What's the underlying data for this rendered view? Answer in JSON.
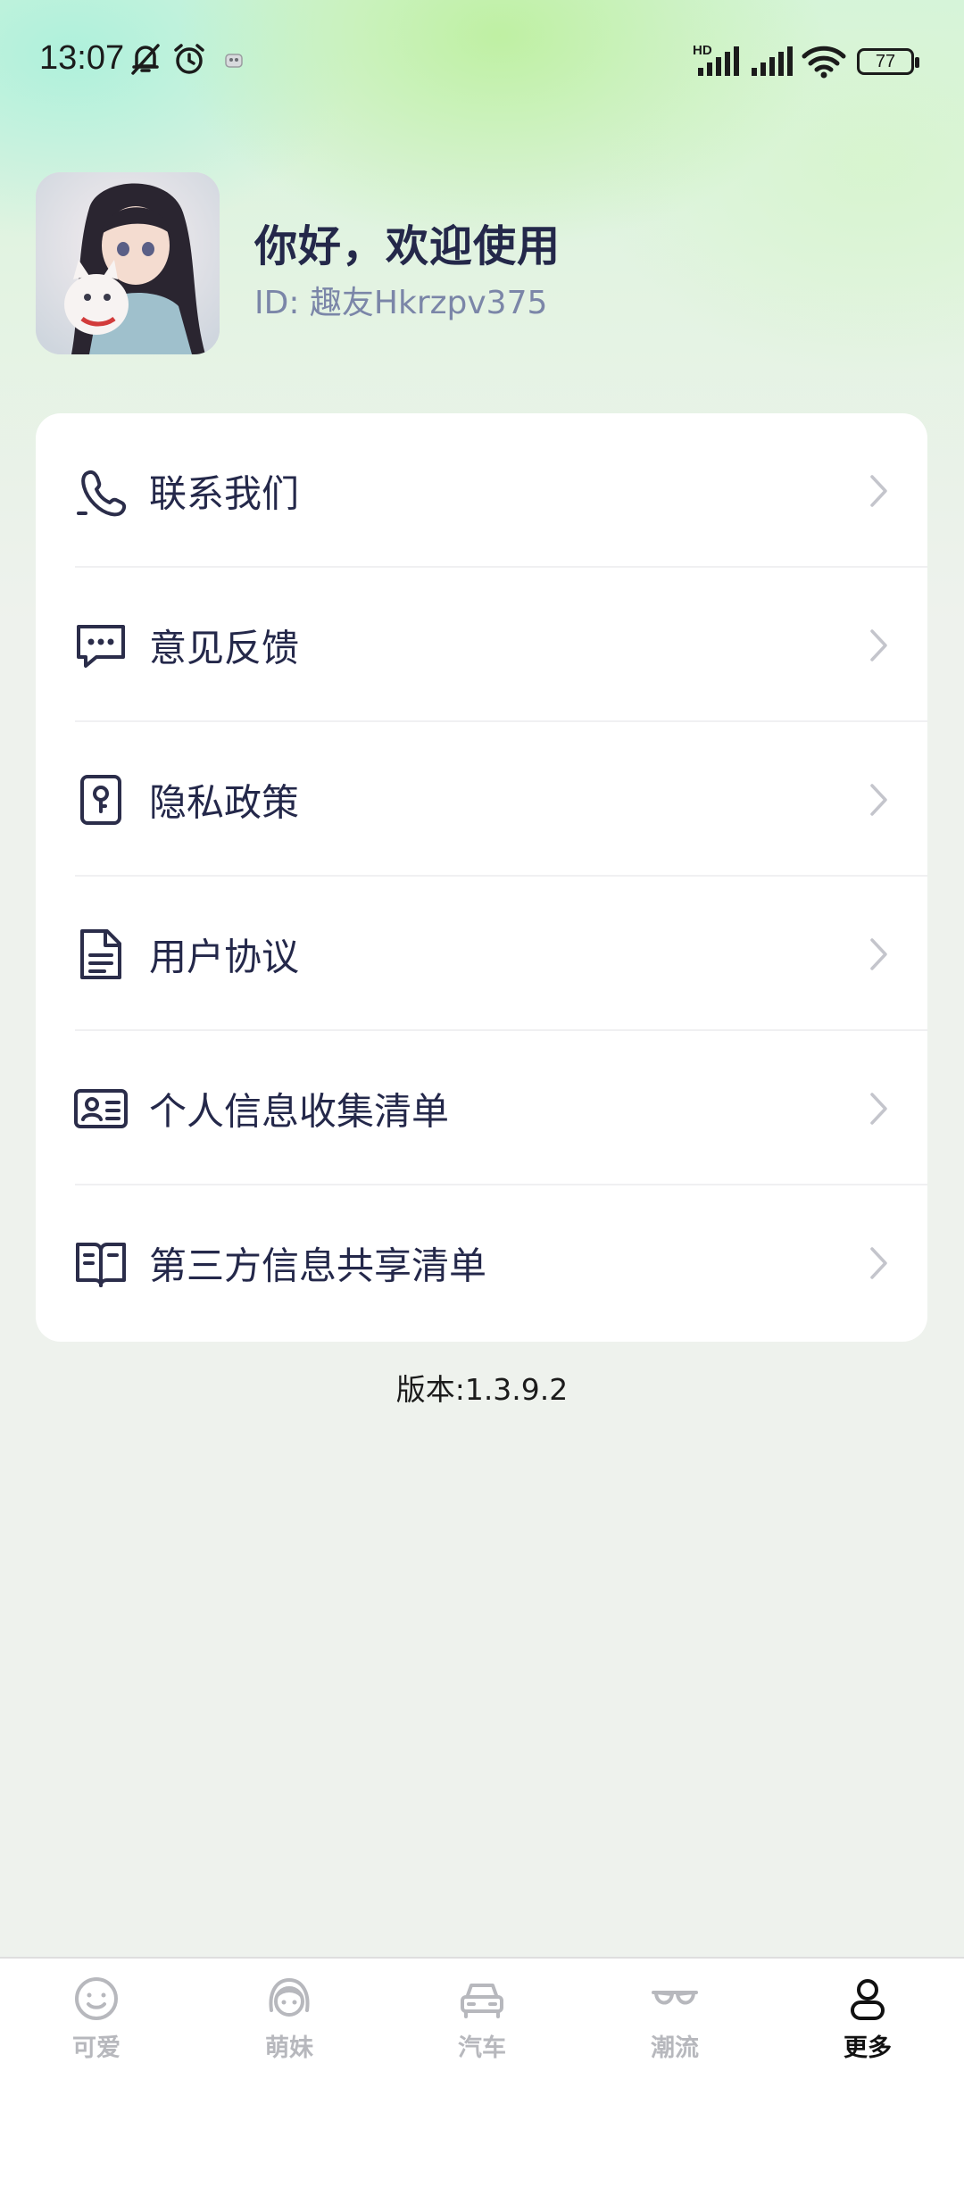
{
  "status_bar": {
    "time": "13:07",
    "network_badge": "HD",
    "battery": "77",
    "icons": [
      "bell-off-icon",
      "alarm-icon",
      "notification-app-icon",
      "signal-icon",
      "signal-icon",
      "wifi-icon",
      "battery-icon"
    ]
  },
  "profile": {
    "greeting": "你好，欢迎使用",
    "user_id": "ID: 趣友Hkrzpv375"
  },
  "menu": {
    "items": [
      {
        "label": "联系我们",
        "icon": "phone-icon"
      },
      {
        "label": "意见反馈",
        "icon": "chat-bubble-icon"
      },
      {
        "label": "隐私政策",
        "icon": "privacy-lock-icon"
      },
      {
        "label": "用户协议",
        "icon": "document-icon"
      },
      {
        "label": "个人信息收集清单",
        "icon": "id-card-icon"
      },
      {
        "label": "第三方信息共享清单",
        "icon": "open-book-icon"
      }
    ]
  },
  "version": "版本:1.3.9.2",
  "tabs": [
    {
      "label": "可爱",
      "icon": "smiley-icon",
      "active": false
    },
    {
      "label": "萌妹",
      "icon": "girl-face-icon",
      "active": false
    },
    {
      "label": "汽车",
      "icon": "car-icon",
      "active": false
    },
    {
      "label": "潮流",
      "icon": "sunglasses-icon",
      "active": false
    },
    {
      "label": "更多",
      "icon": "person-icon",
      "active": true
    }
  ],
  "colors": {
    "accent_text": "#24284a",
    "id_text": "#7b86a8",
    "inactive_tab": "#b7b8bd",
    "active_tab": "#111111"
  },
  "system_nav": [
    "menu-icon",
    "home-icon",
    "back-icon"
  ]
}
